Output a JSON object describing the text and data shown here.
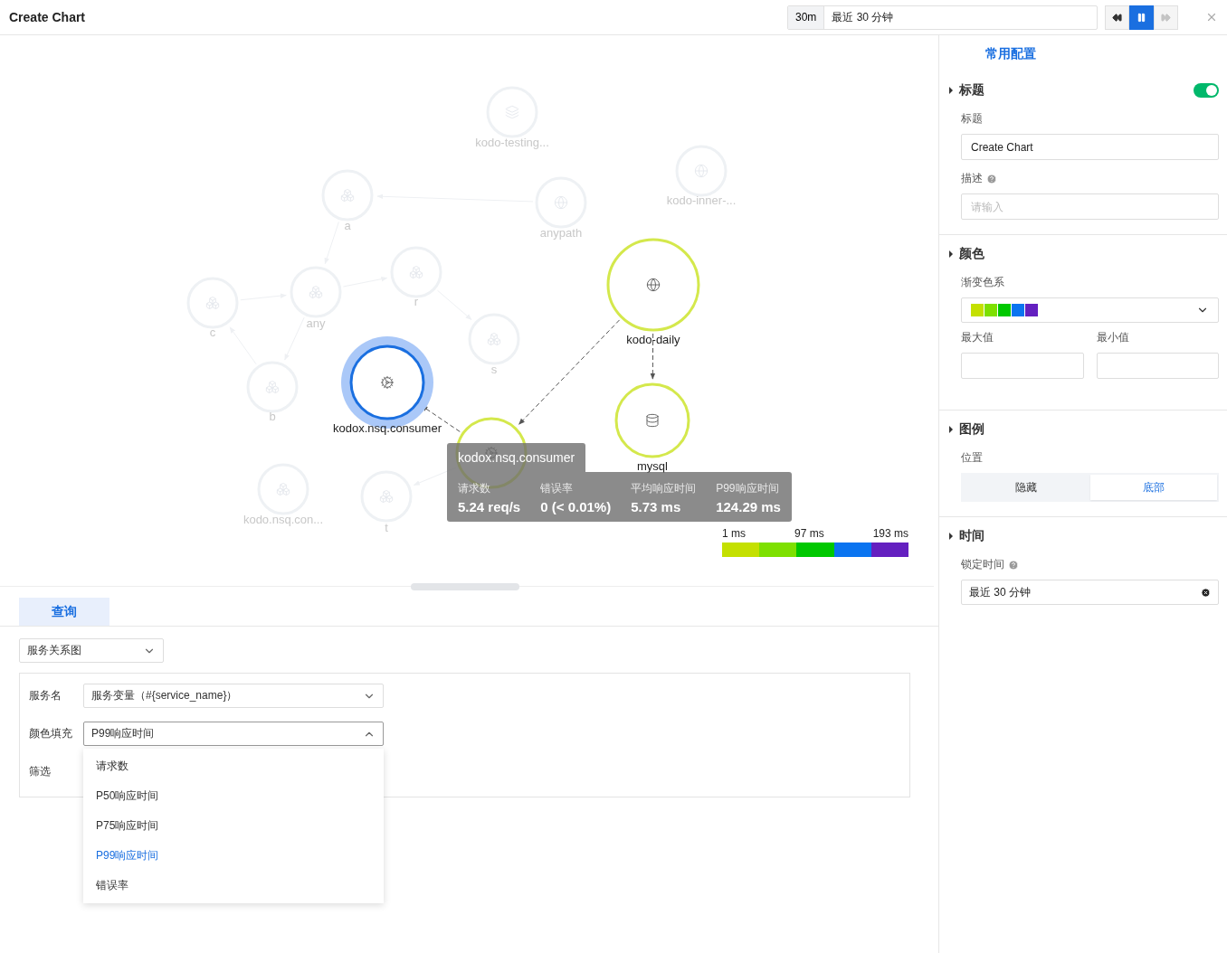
{
  "title": "Create Chart",
  "time_range": {
    "short": "30m",
    "label": "最近 30 分钟"
  },
  "playback": [
    {
      "kind": "rewind",
      "selected": false,
      "disabled": false
    },
    {
      "kind": "pause",
      "selected": true,
      "disabled": false
    },
    {
      "kind": "forward",
      "selected": false,
      "disabled": true
    }
  ],
  "graph": {
    "nodes": [
      {
        "name": "kodo-testing...",
        "kind": "faded",
        "selected": false
      },
      {
        "name": "a",
        "kind": "faded",
        "selected": false
      },
      {
        "name": "anypath",
        "kind": "faded",
        "selected": false
      },
      {
        "name": "kodo-inner-...",
        "kind": "faded",
        "selected": false
      },
      {
        "name": "r",
        "kind": "faded",
        "selected": false
      },
      {
        "name": "any",
        "kind": "faded",
        "selected": false
      },
      {
        "name": "c",
        "kind": "faded",
        "selected": false
      },
      {
        "name": "s",
        "kind": "faded",
        "selected": false
      },
      {
        "name": "b",
        "kind": "faded",
        "selected": false
      },
      {
        "name": "kodox.nsq.consumer",
        "kind": "active",
        "selected": true
      },
      {
        "name": "kodo-daily",
        "kind": "active",
        "selected": false
      },
      {
        "name": "mysql",
        "kind": "active",
        "selected": false
      },
      {
        "kind": "active",
        "selected": false
      },
      {
        "name": "kodo.nsq.con...",
        "kind": "faded",
        "selected": false
      },
      {
        "name": "t",
        "kind": "faded",
        "selected": false
      }
    ],
    "tooltip": {
      "title": "kodox.nsq.consumer",
      "metrics": [
        {
          "label": "请求数",
          "value": "5.24 req/s"
        },
        {
          "label": "错误率",
          "value": "0 (< 0.01%)"
        },
        {
          "label": "平均响应时间",
          "value": "5.73 ms"
        },
        {
          "label": "P99响应时间",
          "value": "124.29 ms"
        }
      ]
    },
    "legend": {
      "labels": [
        "1 ms",
        "97 ms",
        "193 ms"
      ],
      "segments": [
        {
          "color": "#c4e000"
        },
        {
          "color": "#7ee000"
        },
        {
          "color": "#00c800"
        },
        {
          "color": "#0a74f0"
        },
        {
          "color": "#6420c0"
        }
      ]
    }
  },
  "query": {
    "tab": {
      "label": "查询",
      "selected": true
    },
    "chart_type": "服务关系图",
    "rows": [
      {
        "label": "服务名",
        "value": "服务变量（#{service_name}）",
        "open": false
      },
      {
        "label": "颜色填充",
        "value": "P99响应时间",
        "open": true
      },
      {
        "label": "筛选"
      }
    ],
    "options": [
      {
        "label": "请求数",
        "selected": false
      },
      {
        "label": "P50响应时间",
        "selected": false
      },
      {
        "label": "P75响应时间",
        "selected": false
      },
      {
        "label": "P99响应时间",
        "selected": true
      },
      {
        "label": "错误率",
        "selected": false
      }
    ]
  },
  "settings": {
    "tab": "常用配置",
    "title_section": {
      "heading": "标题",
      "toggle_on": true,
      "title_label": "标题",
      "title_value": "Create Chart",
      "desc_label": "描述",
      "desc_placeholder": "请输入"
    },
    "color_section": {
      "heading": "颜色",
      "gradient_label": "渐变色系",
      "swatches": [
        {
          "color": "#c4e000"
        },
        {
          "color": "#7ee000"
        },
        {
          "color": "#00c800"
        },
        {
          "color": "#0a74f0"
        },
        {
          "color": "#6420c0"
        }
      ],
      "max_label": "最大值",
      "min_label": "最小值"
    },
    "legend_section": {
      "heading": "图例",
      "position_label": "位置",
      "options": [
        {
          "label": "隐藏",
          "selected": false
        },
        {
          "label": "底部",
          "selected": true
        }
      ]
    },
    "time_section": {
      "heading": "时间",
      "lock_label": "锁定时间",
      "value": "最近 30 分钟"
    }
  }
}
